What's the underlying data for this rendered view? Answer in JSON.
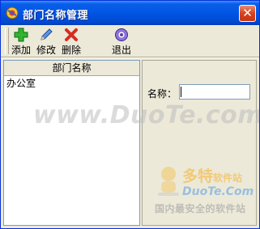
{
  "window": {
    "title": "部门名称管理",
    "close_glyph": "✕",
    "accent_color": "#0055e5"
  },
  "toolbar": {
    "buttons": [
      {
        "label": "添加",
        "icon": "plus-icon",
        "color": "#2aa12a"
      },
      {
        "label": "修改",
        "icon": "pencil-icon",
        "color": "#3a78d8"
      },
      {
        "label": "删除",
        "icon": "cross-icon",
        "color": "#d8281c"
      },
      {
        "label": "退出",
        "icon": "exit-icon",
        "color": "#7b5cc9"
      }
    ]
  },
  "list": {
    "column_header": "部门名称",
    "rows": [
      "办公室"
    ]
  },
  "form": {
    "name_label": "名称：",
    "name_value": ""
  },
  "watermark": {
    "center_text": "www.DuoTe.com",
    "brand": "多特",
    "brand_suffix": "软件站",
    "site": "DuoTe.Com",
    "slogan": "国内最安全的软件站"
  }
}
